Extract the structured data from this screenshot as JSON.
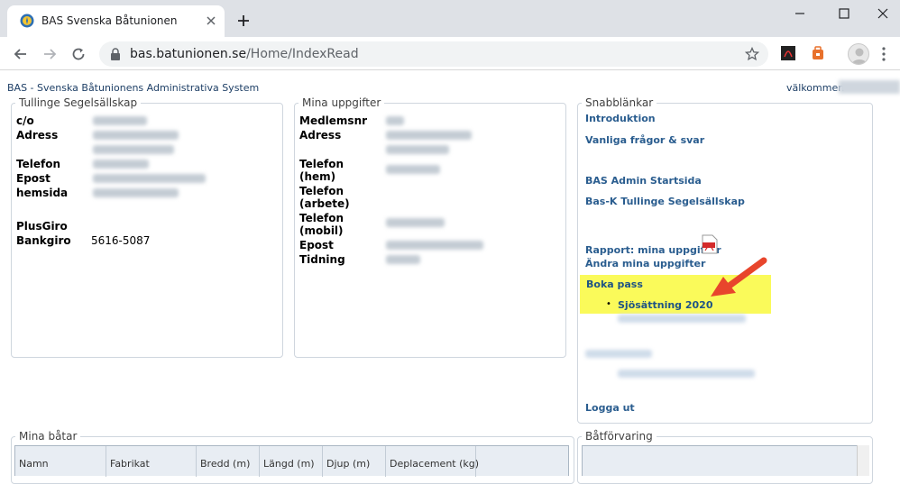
{
  "browser": {
    "tab_title": "BAS Svenska Båtunionen",
    "url_host": "bas.batunionen.se",
    "url_path": "/Home/IndexRead"
  },
  "header": {
    "system_title": "BAS - Svenska Båtunionens Administrativa System",
    "welcome": "välkommen"
  },
  "club": {
    "legend": "Tullinge Segelsällskap",
    "labels": {
      "co": "c/o",
      "address": "Adress",
      "phone": "Telefon",
      "email": "Epost",
      "homepage": "hemsida",
      "plusgiro": "PlusGiro",
      "bankgiro": "Bankgiro"
    },
    "bankgiro_value": "5616-5087"
  },
  "my_info": {
    "legend": "Mina uppgifter",
    "labels": {
      "member_no": "Medlemsnr",
      "address": "Adress",
      "phone_home": "Telefon\n(hem)",
      "phone_work": "Telefon\n(arbete)",
      "phone_mobile": "Telefon\n(mobil)",
      "email": "Epost",
      "magazine": "Tidning"
    }
  },
  "quicklinks": {
    "legend": "Snabblänkar",
    "items": [
      "Introduktion",
      "Vanliga frågor & svar",
      "BAS Admin Startsida",
      "Bas-K Tullinge Segelsällskap",
      "Rapport: mina uppgifter",
      "Ändra mina uppgifter",
      "Boka pass",
      "Sjösättning 2020",
      "Logga ut"
    ]
  },
  "boats": {
    "legend": "Mina båtar",
    "columns": [
      "Namn",
      "Fabrikat",
      "Bredd (m)",
      "Längd (m)",
      "Djup (m)",
      "Deplacement (kg)"
    ]
  },
  "storage": {
    "legend": "Båtförvaring"
  },
  "colors": {
    "link": "#2a5d8f",
    "highlight": "#fafa5a",
    "arrow": "#e8452c"
  }
}
